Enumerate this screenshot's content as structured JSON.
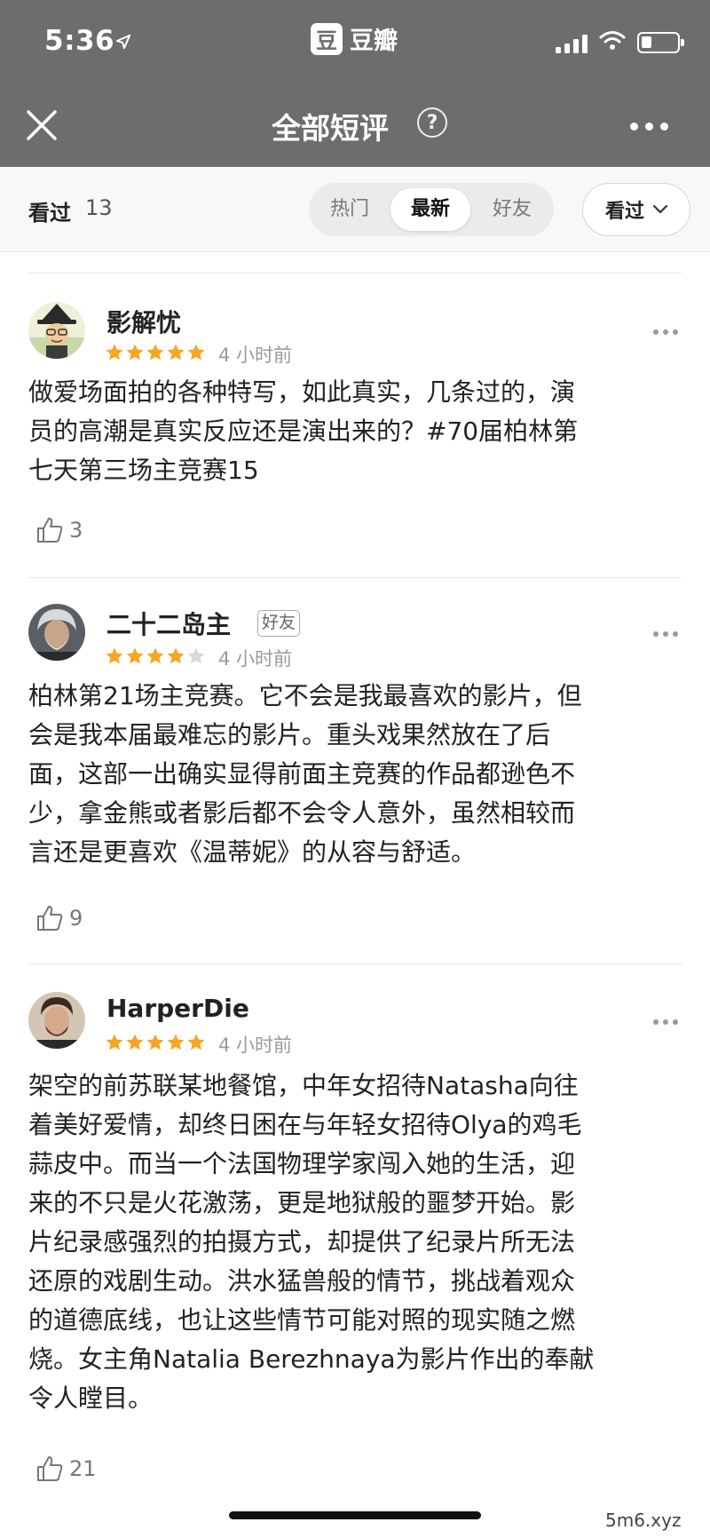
{
  "status_bar": {
    "time": "5:36",
    "battery_level": 0.3
  },
  "app": {
    "brand_glyph": "豆",
    "brand_name": "豆瓣"
  },
  "nav": {
    "title": "全部短评",
    "help_glyph": "?"
  },
  "filter": {
    "seen_label": "看过",
    "seen_count": "13",
    "tabs": [
      "热门",
      "最新",
      "好友"
    ],
    "active_tab": "最新",
    "dropdown_label": "看过"
  },
  "reviews": [
    {
      "author": "影解忧",
      "rating": 5,
      "time": "4 小时前",
      "text_lines": [
        "做爱场面拍的各种特写，如此真实，几条过的，演",
        "员的高潮是真实反应还是演出来的？#70届柏林第",
        "七天第三场主竞赛15"
      ],
      "likes": "3"
    },
    {
      "author": "二十二岛主",
      "badge": "好友",
      "rating": 4,
      "time": "4 小时前",
      "text_lines": [
        "柏林第21场主竞赛。它不会是我最喜欢的影片，但",
        "会是我本届最难忘的影片。重头戏果然放在了后",
        "面，这部一出确实显得前面主竞赛的作品都逊色不",
        "少，拿金熊或者影后都不会令人意外，虽然相较而",
        "言还是更喜欢《温蒂妮》的从容与舒适。"
      ],
      "likes": "9"
    },
    {
      "author": "HarperDie",
      "rating": 5,
      "time": "4 小时前",
      "text_lines": [
        "架空的前苏联某地餐馆，中年女招待Natasha向往",
        "着美好爱情，却终日困在与年轻女招待Olya的鸡毛",
        "蒜皮中。而当一个法国物理学家闯入她的生活，迎",
        "来的不只是火花激荡，更是地狱般的噩梦开始。影",
        "片纪录感强烈的拍摄方式，却提供了纪录片所无法",
        "还原的戏剧生动。洪水猛兽般的情节，挑战着观众",
        "的道德底线，也让这些情节可能对照的现实随之燃",
        "烧。女主角Natalia Berezhnaya为影片作出的奉献",
        "令人瞠目。"
      ],
      "likes": "21"
    }
  ],
  "watermark": "5m6.xyz",
  "colors": {
    "header_bg": "#6d6d6d",
    "star": "#f6a623",
    "star_empty": "#d8d8d8"
  }
}
